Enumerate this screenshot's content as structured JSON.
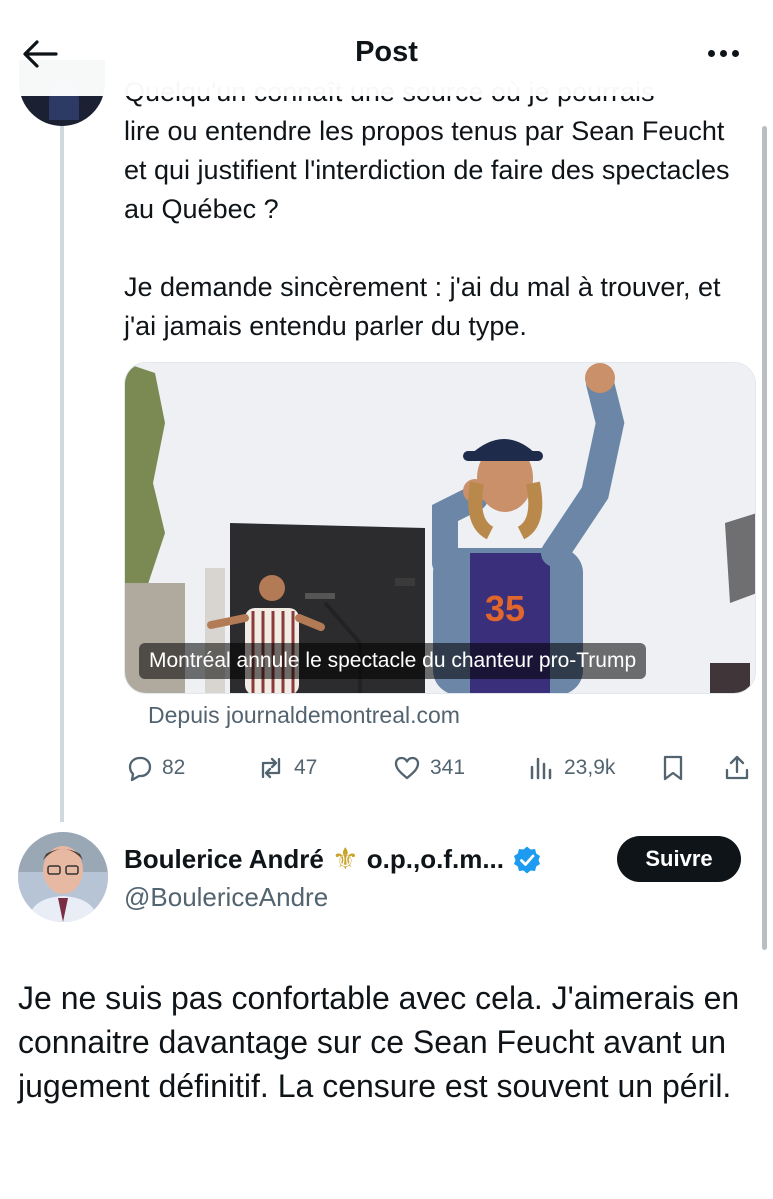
{
  "header": {
    "title": "Post"
  },
  "original_tweet": {
    "cropped_first_line": "Quelqu'un connaît une source où je pourrais",
    "paragraphs": [
      "lire ou entendre les propos tenus par Sean Feucht et qui justifient l'interdiction de faire des spectacles au Québec ?",
      "Je demande sincèrement : j'ai du mal à trouver, et j'ai jamais entendu parler du type."
    ],
    "card": {
      "caption": "Montréal annule le spectacle du chanteur pro-Trump",
      "source": "Depuis journaldemontreal.com"
    },
    "actions": {
      "replies": "82",
      "reposts": "47",
      "likes": "341",
      "views": "23,9k"
    }
  },
  "reply": {
    "author_name": "Boulerice André",
    "name_suffix": "o.p.,o.f.m...",
    "handle": "@BoulericeAndre",
    "follow_label": "Suivre",
    "text": "Je ne suis pas confortable avec cela. J'aimerais en connaitre davantage sur ce Sean Feucht avant un jugement définitif. La censure est souvent un péril."
  },
  "colors": {
    "text": "#0f1419",
    "secondary": "#536471",
    "verified": "#1d9bf0",
    "thread_line": "#cfd9de"
  }
}
